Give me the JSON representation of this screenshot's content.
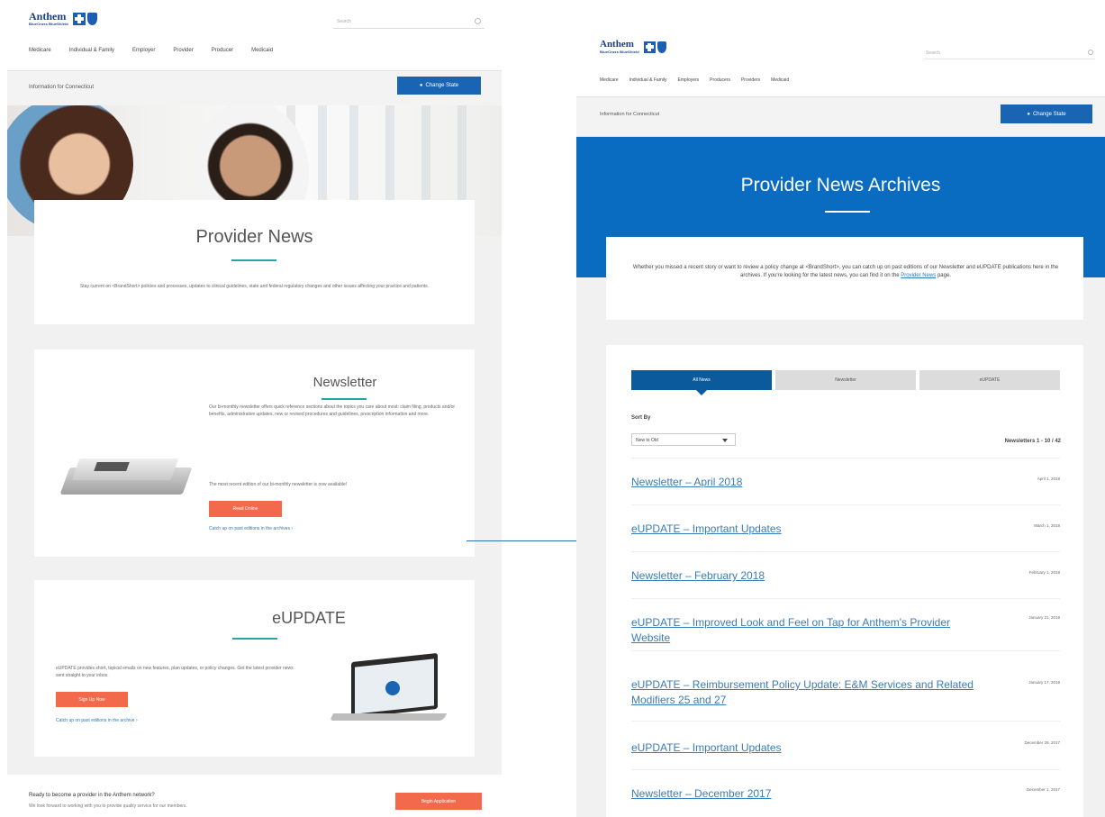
{
  "left": {
    "brand": {
      "wordmark": "Anthem",
      "sub": "BlueCross BlueShield"
    },
    "search_placeholder": "Search",
    "nav": [
      "Medicare",
      "Individual & Family",
      "Employer",
      "Provider",
      "Producer",
      "Medicaid"
    ],
    "info_text": "Information for Connecticut",
    "change_state_label": "Change State",
    "provider_news": {
      "title": "Provider News",
      "body": "Stay current on <BrandShort> policies and processes, updates to clinical guidelines, state and federal regulatory changes and other issues affecting your practice and patients."
    },
    "newsletter": {
      "title": "Newsletter",
      "body": "Our bi-monthly newsletter offers quick reference sections about the topics you care about most: claim filing, products and/or benefits, administrative updates, new or revised procedures and guidelines, prescription information and more.",
      "body2": "The most recent edition of our bi-monthly newsletter is now available!",
      "button": "Read Online",
      "archive_link": "Catch up on past editions in the archives"
    },
    "eupdate": {
      "title": "eUPDATE",
      "body": "eUPDATE provides short, topical emails on new features, plan updates, or policy changes. Get the latest provider news sent straight to your inbox.",
      "button": "Sign Up Now",
      "archive_link": "Catch up on past editions in the archive"
    },
    "footer": {
      "heading": "Ready to become a provider in the Anthem network?",
      "text": "We look forward to working with you to provide quality service for our members.",
      "button": "Begin Application"
    }
  },
  "right": {
    "brand": {
      "wordmark": "Anthem",
      "sub": "BlueCross BlueShield"
    },
    "search_placeholder": "Search",
    "nav": [
      "Medicare",
      "Individual & Family",
      "Employers",
      "Producers",
      "Providers",
      "Medicaid"
    ],
    "info_text": "Information for Connecticut",
    "change_state_label": "Change State",
    "title": "Provider News Archives",
    "intro_before": "Whether you missed a recent story or want to review a policy change at <BrandShort>, you can catch up on past editions of our Newsletter and eUPDATE publications here in the archives. If you're looking for the latest news, you can find it on the ",
    "intro_link": "Provider News",
    "intro_after": " page.",
    "tabs": [
      "All News",
      "Newsletter",
      "eUPDATE"
    ],
    "sort_label": "Sort By",
    "sort_value": "New to Old",
    "count_text": "Newsletters 1 - 10 / 42",
    "items": [
      {
        "title": "Newsletter – April 2018",
        "date": "April 1, 2018"
      },
      {
        "title": "eUPDATE – Important Updates",
        "date": "March 1, 2018"
      },
      {
        "title": "Newsletter – February 2018",
        "date": "February 1, 2018"
      },
      {
        "title": "eUPDATE – Improved Look and Feel on Tap for Anthem's Provider Website",
        "date": "January 21, 2018"
      },
      {
        "title": "eUPDATE – Reimbursement Policy Update: E&M Services and Related Modifiers 25 and 27",
        "date": "January 17, 2018"
      },
      {
        "title": "eUPDATE – Important Updates",
        "date": "December 29, 2017"
      },
      {
        "title": "Newsletter – December 2017",
        "date": "December 1, 2017"
      }
    ]
  },
  "colors": {
    "brand_blue": "#0a6cc0",
    "orange": "#f26a4b",
    "teal": "#26a5a5",
    "link": "#3a7cb8"
  }
}
